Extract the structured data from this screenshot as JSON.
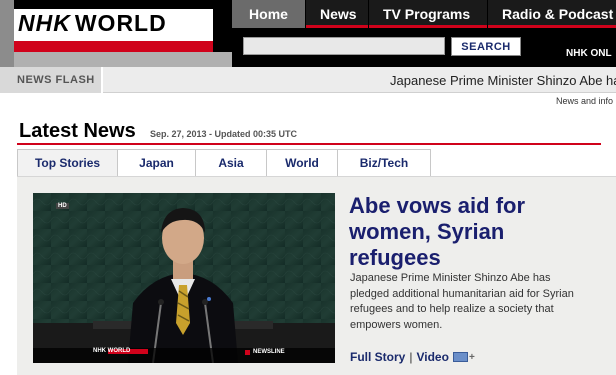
{
  "brand": {
    "logo_prefix": "NHK",
    "logo_suffix": "WORLD"
  },
  "nav": {
    "tabs": [
      {
        "label": "Home"
      },
      {
        "label": "News"
      },
      {
        "label": "TV Programs"
      },
      {
        "label": "Radio & Podcast"
      }
    ]
  },
  "search": {
    "value": "",
    "button_label": "SEARCH"
  },
  "nhk_online": "NHK ONL",
  "news_flash": {
    "label": "NEWS FLASH",
    "text": "Japanese Prime Minister Shinzo Abe has",
    "info": "News and info"
  },
  "latest": {
    "title": "Latest News",
    "date": "Sep. 27, 2013 - Updated 00:35 UTC",
    "tabs": [
      {
        "label": "Top Stories"
      },
      {
        "label": "Japan"
      },
      {
        "label": "Asia"
      },
      {
        "label": "World"
      },
      {
        "label": "Biz/Tech"
      }
    ]
  },
  "story": {
    "headline": "Abe vows aid for women, Syrian refugees",
    "summary": "Japanese Prime Minister Shinzo Abe has pledged additional humanitarian aid for Syrian refugees and to help realize a society that empowers women.",
    "full_story_label": "Full Story",
    "separator": "|",
    "video_label": "Video",
    "video_plus": "+",
    "photo": {
      "hd_badge": "HD",
      "watermark": "NHK WORLD",
      "ticker": "NEWSLINE"
    }
  },
  "colors": {
    "brand_red": "#d0021b",
    "link_navy": "#1a2a6c",
    "headline_navy": "#1a1f6e"
  }
}
